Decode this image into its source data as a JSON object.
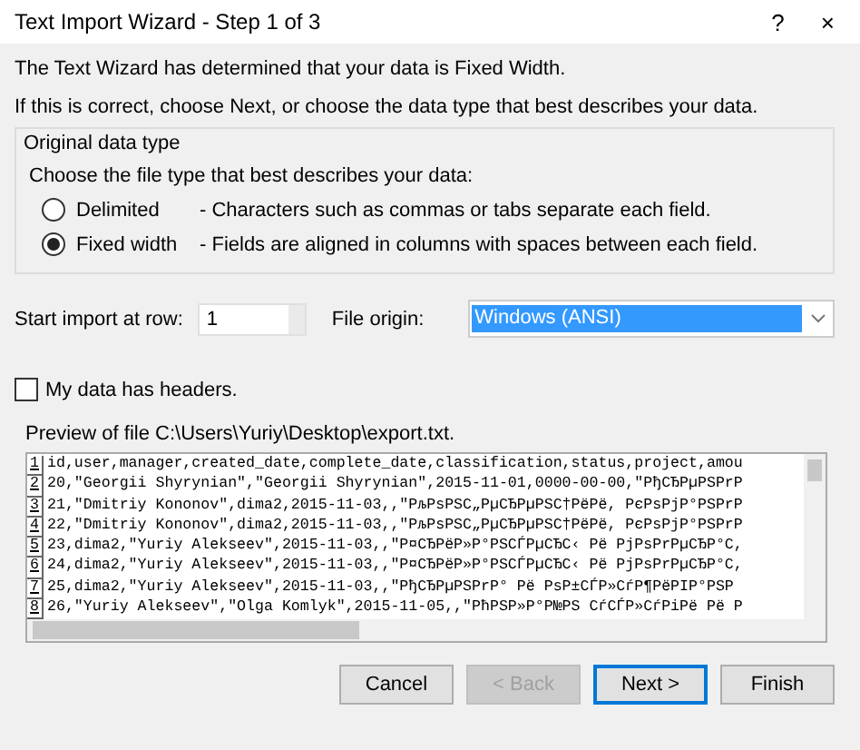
{
  "window": {
    "title": "Text Import Wizard - Step 1 of 3",
    "help": "?",
    "close": "×"
  },
  "intro": "The Text Wizard has determined that your data is Fixed Width.",
  "instruction": "If this is correct, choose Next, or choose the data type that best describes your data.",
  "group": {
    "title": "Original data type",
    "prompt": "Choose the file type that best describes your data:",
    "options": [
      {
        "label": "Delimited",
        "description": "- Characters such as commas or tabs separate each field.",
        "selected": false
      },
      {
        "label": "Fixed width",
        "description": "- Fields are aligned in columns with spaces between each field.",
        "selected": true
      }
    ]
  },
  "start_row": {
    "label": "Start import at row:",
    "value": "1"
  },
  "file_origin": {
    "label": "File origin:",
    "value": "Windows (ANSI)"
  },
  "headers": {
    "label": "My data has headers.",
    "checked": false
  },
  "preview": {
    "label": "Preview of file C:\\Users\\Yuriy\\Desktop\\export.txt.",
    "lines": [
      {
        "number": "1",
        "text": "id,user,manager,created_date,complete_date,classification,status,project,amou"
      },
      {
        "number": "2",
        "text": "20,\"Georgii Shyrynian\",\"Georgii Shyrynian\",2015-11-01,0000-00-00,\"PђCЂPµPSPrP"
      },
      {
        "number": "3",
        "text": "21,\"Dmitriy Kononov\",dima2,2015-11-03,,\"PљPsPSC„PµCЂPµPSC†PëPë, PєPsPjP°PSPrP"
      },
      {
        "number": "4",
        "text": "22,\"Dmitriy Kononov\",dima2,2015-11-03,,\"PљPsPSC„PµCЂPµPSC†PëPë, PєPsPjP°PSPrP"
      },
      {
        "number": "5",
        "text": "23,dima2,\"Yuriy Alekseev\",2015-11-03,,\"P¤CЂPëP»P°PSCЃPµCЂC‹ Pë PjPsPrPµCЂP°C,"
      },
      {
        "number": "6",
        "text": "24,dima2,\"Yuriy Alekseev\",2015-11-03,,\"P¤CЂPëP»P°PSCЃPµCЂC‹ Pë PjPsPrPµCЂP°C,"
      },
      {
        "number": "7",
        "text": "25,dima2,\"Yuriy Alekseev\",2015-11-03,,\"PђCЂPµPSPrP° Pë PsP±CЃP»CѓP¶PëPIP°PSP"
      },
      {
        "number": "8",
        "text": "26,\"Yuriy Alekseev\",\"Olga Komlyk\",2015-11-05,,\"PћPSP»P°P№PS CѓCЃP»CѓPiPë Pë P"
      }
    ]
  },
  "buttons": [
    {
      "label": "Cancel",
      "disabled": false,
      "default": false
    },
    {
      "label": "< Back",
      "disabled": true,
      "default": false
    },
    {
      "label": "Next >",
      "disabled": false,
      "default": true
    },
    {
      "label": "Finish",
      "disabled": false,
      "default": false
    }
  ]
}
